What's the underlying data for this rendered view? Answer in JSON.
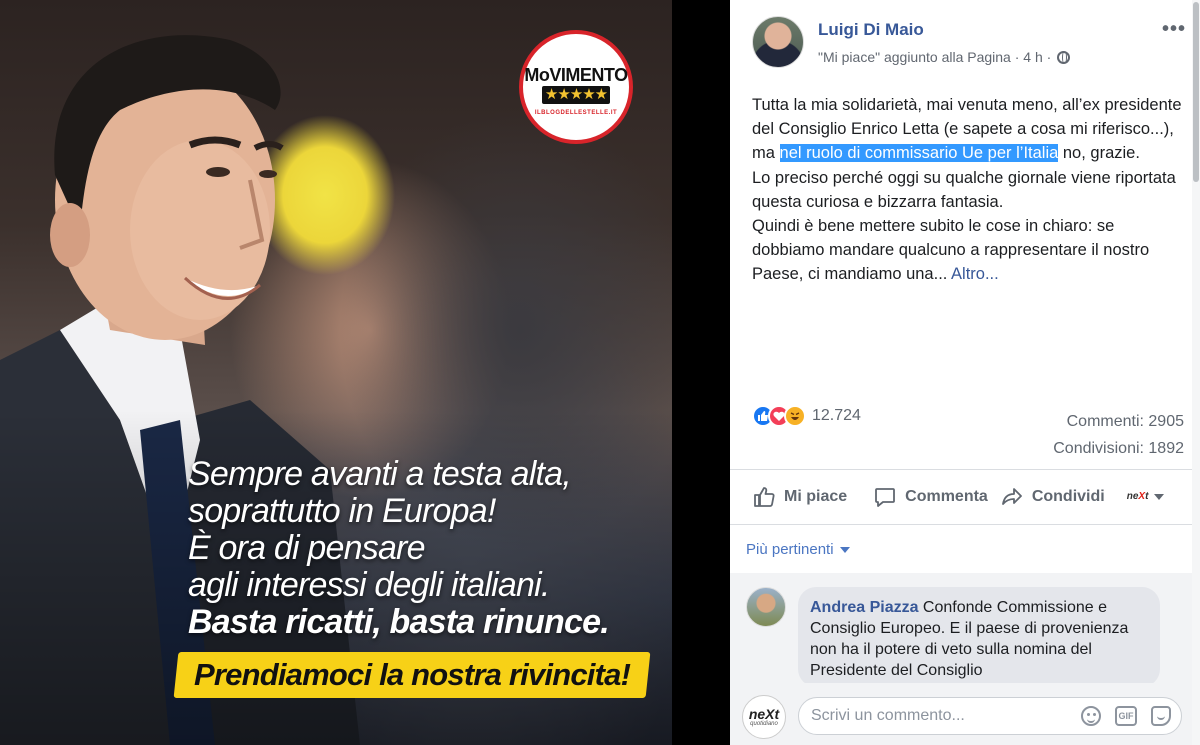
{
  "photo": {
    "logo_word": "MoVIMENTO",
    "logo_stars": "★★★★★",
    "logo_ribbon": "ILBLOGDELLESTELLE.IT",
    "slogan_lines": [
      "Sempre avanti a testa alta,",
      "soprattutto in Europa!",
      "È ora di pensare",
      "agli interessi degli italiani.",
      "Basta ricatti, basta rinunce."
    ],
    "banner": "Prendiamoci la nostra rivincita!"
  },
  "post": {
    "author": "Luigi Di Maio",
    "meta": "\"Mi piace\" aggiunto alla Pagina · 4 h ·",
    "more_icon": "•••",
    "text_p1_before": "Tutta la mia solidarietà, mai venuta meno, all’ex presidente del Consiglio Enrico Letta (e sapete a cosa mi riferisco...), ma ",
    "text_p1_highlight": "nel ruolo di commissario Ue per l’Italia",
    "text_p1_after": " no, grazie.",
    "text_p2": "Lo preciso perché oggi su qualche giornale viene riportata questa curiosa e bizzarra fantasia.",
    "text_p3_before": "Quindi è bene mettere subito le cose in chiaro: se dobbiamo mandare qualcuno a rappresentare il nostro Paese, ci mandiamo una... ",
    "more_link": "Altro...",
    "reaction_count": "12.724",
    "comments_count": "Commenti: 2905",
    "shares_count": "Condivisioni: 1892"
  },
  "actions": {
    "like": "Mi piace",
    "comment": "Commenta",
    "share": "Condividi"
  },
  "sort_label": "Più pertinenti",
  "comment": {
    "author": "Andrea Piazza",
    "text": " Confonde Commissione e Consiglio Europeo. E il paese di provenienza non ha il potere di veto sulla nomina del Presidente del Consiglio"
  },
  "composer": {
    "placeholder": "Scrivi un commento...",
    "logo_text": "neXt",
    "logo_sub": "quotidiano"
  },
  "colors": {
    "link_blue": "#385898",
    "highlight": "#3399ff",
    "banner_yellow": "#f7d117"
  }
}
